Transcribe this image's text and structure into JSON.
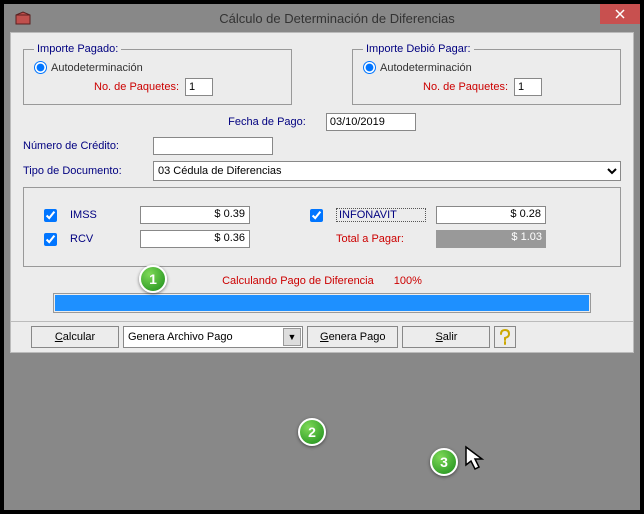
{
  "title": "Cálculo de Determinación de Diferencias",
  "groupPaid": {
    "legend": "Importe Pagado:",
    "radio": "Autodeterminación",
    "pkgLabel": "No. de Paquetes:",
    "pkgValue": "1"
  },
  "groupOwed": {
    "legend": "Importe Debió Pagar:",
    "radio": "Autodeterminación",
    "pkgLabel": "No. de Paquetes:",
    "pkgValue": "1"
  },
  "fechaLabel": "Fecha de Pago:",
  "fechaValue": "03/10/2019",
  "creditoLabel": "Número de Crédito:",
  "creditoValue": "",
  "docLabel": "Tipo de Documento:",
  "docValue": "03 Cédula de Diferencias",
  "checks": {
    "imss": {
      "label": "IMSS",
      "amount": "$ 0.39"
    },
    "rcv": {
      "label": "RCV",
      "amount": "$ 0.36"
    },
    "infonavit": {
      "label": "INFONAVIT",
      "amount": "$ 0.28"
    },
    "totalLabel": "Total a Pagar:",
    "totalAmount": "$ 1.03"
  },
  "status": {
    "text": "Calculando Pago de Diferencia",
    "pct": "100%"
  },
  "buttons": {
    "calcular": "Calcular",
    "combo": "Genera Archivo Pago",
    "genera": "Genera Pago",
    "salir": "Salir"
  },
  "help": "?"
}
